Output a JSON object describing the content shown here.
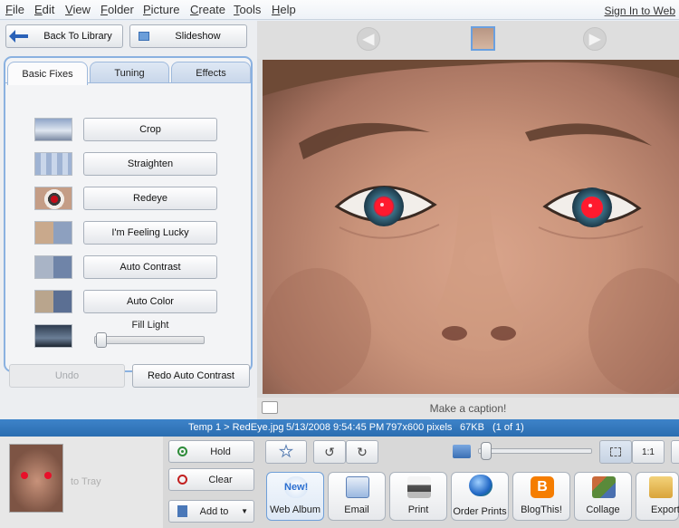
{
  "menu": [
    "File",
    "Edit",
    "View",
    "Folder",
    "Picture",
    "Create",
    "Tools",
    "Help"
  ],
  "signin": "Sign In to Web",
  "nav": {
    "back": "Back To Library",
    "slideshow": "Slideshow"
  },
  "tabs": [
    "Basic Fixes",
    "Tuning",
    "Effects"
  ],
  "fixes": [
    "Crop",
    "Straighten",
    "Redeye",
    "I'm Feeling Lucky",
    "Auto Contrast",
    "Auto Color"
  ],
  "fill_light": {
    "label": "Fill Light",
    "value": 0
  },
  "undo": "Undo",
  "redo": "Redo Auto Contrast",
  "caption_placeholder": "Make a caption!",
  "status": {
    "folder": "Temp 1 > RedEye.jpg",
    "date": "5/13/2008 9:54:45 PM",
    "dims": "797x600 pixels",
    "size": "67KB",
    "count": "(1 of 1)"
  },
  "tray": {
    "hint": "to Tray",
    "hold": "Hold",
    "clear": "Clear",
    "add_to": "Add to"
  },
  "toolbar": {
    "ratio": "1:1",
    "zoom_value": 0
  },
  "actions": [
    "Web Album",
    "Email",
    "Print",
    "Order Prints",
    "BlogThis!",
    "Collage",
    "Export"
  ],
  "web_album_badge": "New!",
  "colors": {
    "status_bar": "#2f72b6",
    "tab_border": "#8ab1e0",
    "redeye": "#e8102a"
  }
}
